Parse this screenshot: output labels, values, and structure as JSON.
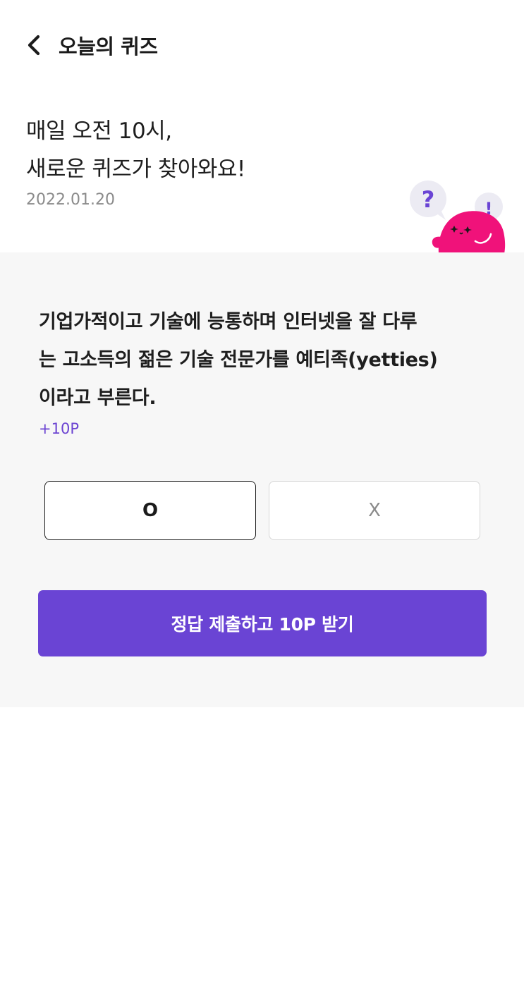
{
  "header": {
    "back_icon": "chevron-left-icon",
    "title": "오늘의 퀴즈"
  },
  "intro": {
    "line1": "매일 오전 10시,",
    "line2": "새로운 퀴즈가 찾아와요!",
    "date": "2022.01.20"
  },
  "mascot": {
    "bubble_question": "?",
    "bubble_exclaim": "!"
  },
  "quiz": {
    "question_lines": [
      "기업가적이고 기술에 능통하며 인터넷을 잘 다루",
      "는 고소득의 젊은 기술 전문가를 예티족(yetties)",
      "이라고 부른다."
    ],
    "points": "+10P",
    "options": {
      "o_label": "O",
      "x_label": "X",
      "selected": "O"
    },
    "submit_label": "정답 제출하고 10P 받기"
  },
  "colors": {
    "accent": "#6a44d4",
    "points_text": "#6c44d2",
    "mascot": "#f0127a",
    "quiz_background": "#f7f7f7"
  }
}
